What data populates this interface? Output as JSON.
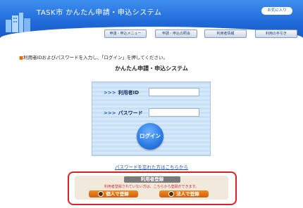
{
  "header": {
    "title": "TASK市 かんたん申請・申込システム",
    "favorite_label": "お気に入り",
    "nav": [
      {
        "label": "申請・申込メニュー"
      },
      {
        "label": "申請・申込の照会"
      },
      {
        "label": "利用者情報"
      },
      {
        "label": "利用の手引き"
      }
    ]
  },
  "notice": {
    "bullet": "■",
    "text": "利用者IDおよびパスワードを入力し、「ログイン」を押してください。"
  },
  "subtitle": "かんたん申請・申込システム",
  "login": {
    "arrow": ">>>",
    "userid_label": "利用者ID",
    "password_label": "パスワード",
    "userid_value": "",
    "password_value": "",
    "login_button": "ログイン"
  },
  "forgot_link": "パスワードを忘れた方はこちらから",
  "registration": {
    "title": "利用者登録",
    "description": "利用者登録されていない方は、こちらから登録ができます。",
    "individual_button": "個人で登録",
    "corporate_button": "法人で登録"
  },
  "colors": {
    "header_blue": "#1f69d8",
    "accent_orange": "#e46c00",
    "reg_border_red": "#e02020"
  }
}
